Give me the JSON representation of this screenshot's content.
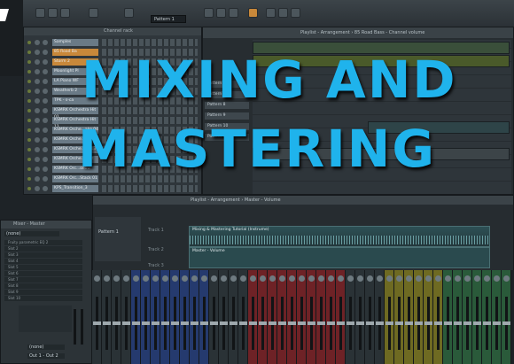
{
  "toolbar": {
    "pattern_select": "Pattern 1"
  },
  "channel_rack": {
    "title": "Channel rack",
    "channels": [
      {
        "label": "Samples",
        "highlight": false
      },
      {
        "label": "85 Road Ba",
        "highlight": true
      },
      {
        "label": "Storm 2",
        "highlight": true
      },
      {
        "label": "Moonlight Pl",
        "highlight": false
      },
      {
        "label": "LA Piano WF",
        "highlight": false
      },
      {
        "label": "Weatherb 2",
        "highlight": false
      },
      {
        "label": "TPK - s-ca",
        "highlight": false
      },
      {
        "label": "KSMRK Orchestra Hit 01",
        "highlight": false
      },
      {
        "label": "KSMRK Orchestra Hit 11",
        "highlight": false
      },
      {
        "label": "KSMRK Orche...ake 04",
        "highlight": false
      },
      {
        "label": "KSMRK Orche...ake 05",
        "highlight": false
      },
      {
        "label": "KSMRK Orche...oll 13",
        "highlight": false
      },
      {
        "label": "KSMRK Orche...t Hit",
        "highlight": false
      },
      {
        "label": "KSMRK Orc...ollow",
        "highlight": false
      },
      {
        "label": "KSMRK Orc...Stack 01",
        "highlight": false
      },
      {
        "label": "KPS_Transition_3",
        "highlight": false
      }
    ]
  },
  "playlist_top": {
    "title": "Playlist - Arrangement › 85 Road Bass - Channel volume",
    "patterns": [
      "Pattern 6",
      "Pattern 7",
      "Pattern 8",
      "Pattern 9",
      "Pattern 10",
      "Pattern 11"
    ]
  },
  "mixer": {
    "title": "Mixer - Master",
    "preset": "(none)",
    "slots": [
      "Fruity parametric EQ 2",
      "Slot 2",
      "Slot 3",
      "Slot 4",
      "Slot 5",
      "Slot 6",
      "Slot 7",
      "Slot 8",
      "Slot 9",
      "Slot 10"
    ],
    "output_label": "(none)",
    "output_select": "Out 1 - Out 2"
  },
  "playlist_bottom": {
    "title": "Playlist - Arrangement › Master - Volume",
    "pattern": "Pattern 1",
    "tracks": [
      "Track 1",
      "Track 2",
      "Track 3"
    ],
    "clips": [
      "Mixing & Mastering Tutorial (Instrume)",
      "Master - Volume"
    ]
  },
  "headline": {
    "line1": "MIXING AND",
    "line2": "MASTERING"
  },
  "colors": {
    "headline": "#1fb3ec",
    "channel_highlight": "#c8883a",
    "mixer_blue": "#253a6e",
    "mixer_red": "#6e2226",
    "mixer_yellow": "#6e6a22",
    "mixer_green": "#2a5a3a"
  }
}
